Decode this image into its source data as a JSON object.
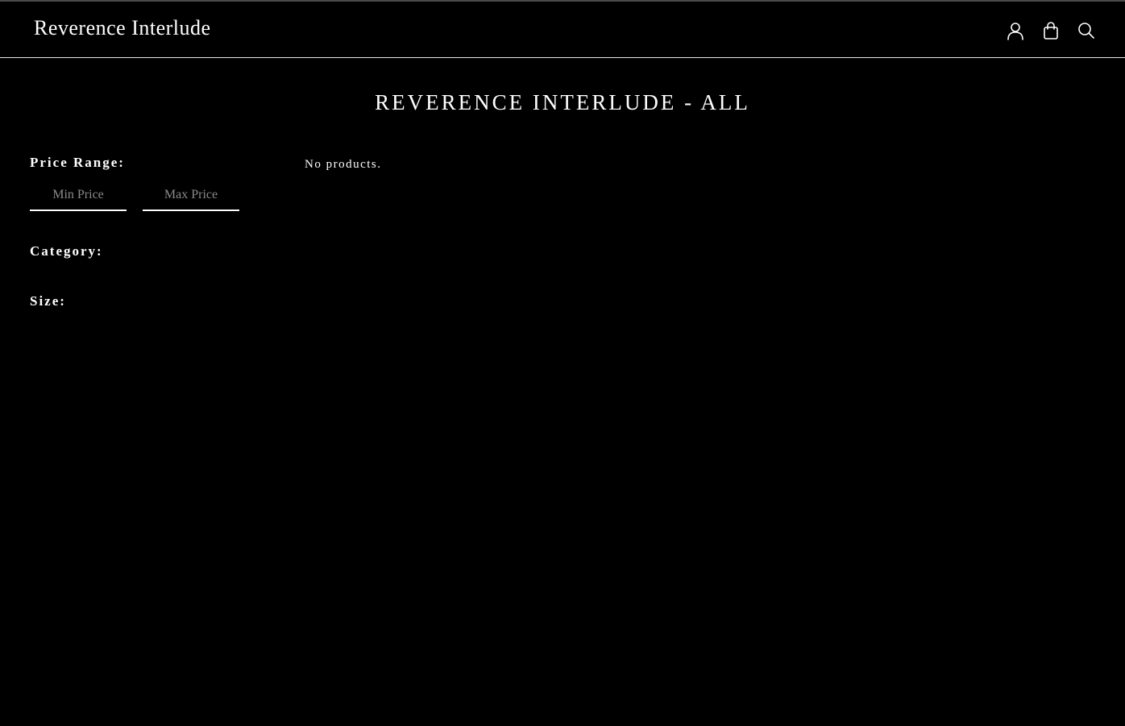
{
  "header": {
    "brand": "Reverence Interlude",
    "icons": [
      "account-icon",
      "cart-icon",
      "search-icon"
    ]
  },
  "main": {
    "title": "REVERENCE INTERLUDE - ALL",
    "empty_message": "No products."
  },
  "filters": {
    "price_label": "Price Range:",
    "min_placeholder": "Min Price",
    "max_placeholder": "Max Price",
    "category_label": "Category:",
    "size_label": "Size:"
  },
  "colors": {
    "background": "#000000",
    "text": "#ffffff",
    "placeholder": "#8a8a8a"
  }
}
